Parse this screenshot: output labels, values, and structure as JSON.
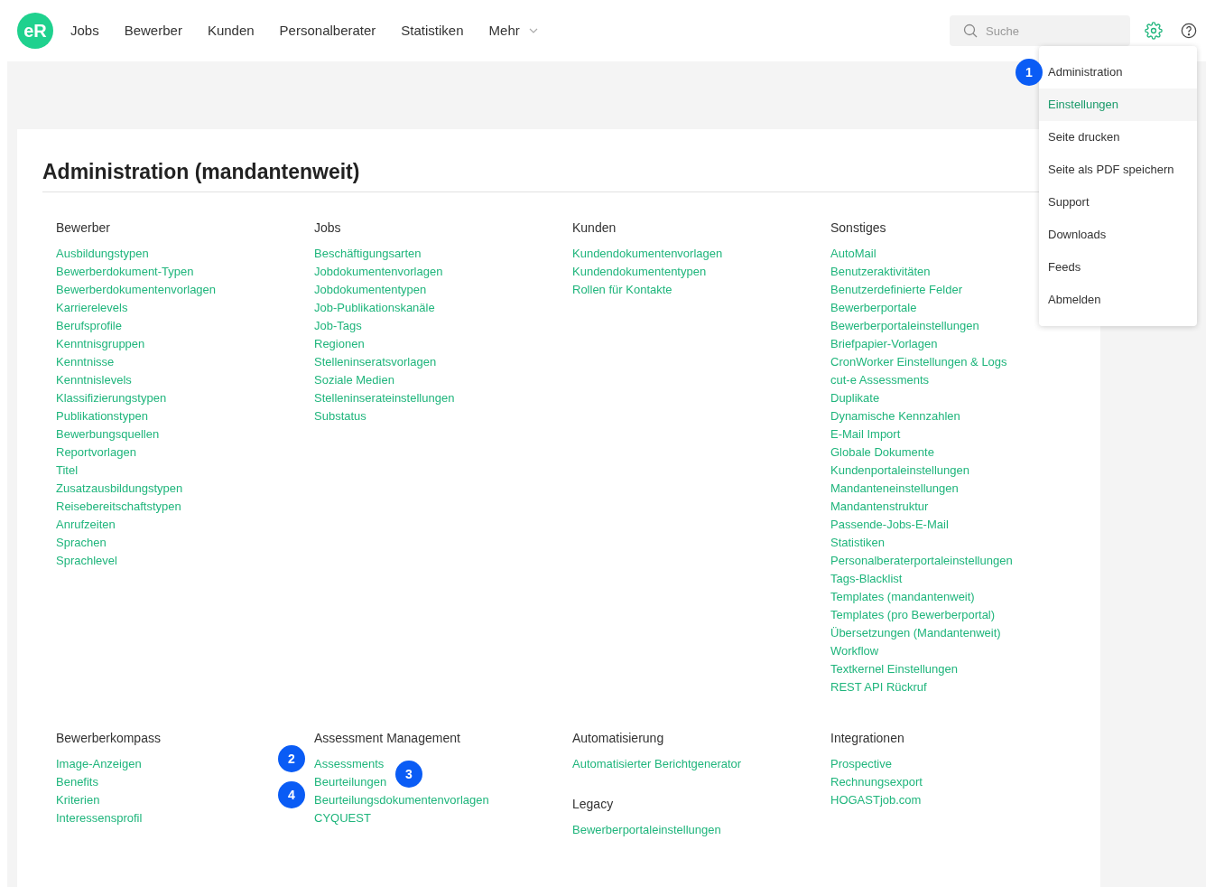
{
  "nav": {
    "logo": "eR",
    "items": [
      {
        "label": "Jobs"
      },
      {
        "label": "Bewerber"
      },
      {
        "label": "Kunden"
      },
      {
        "label": "Personalberater"
      },
      {
        "label": "Statistiken"
      },
      {
        "label": "Mehr",
        "dropdown": true
      }
    ],
    "search": {
      "placeholder": "Suche"
    }
  },
  "menu": {
    "items": [
      {
        "label": "Administration",
        "highlighted": false,
        "marker": "1"
      },
      {
        "label": "Einstellungen",
        "highlighted": true
      },
      {
        "label": "Seite drucken",
        "highlighted": false
      },
      {
        "label": "Seite als PDF speichern",
        "highlighted": false
      },
      {
        "label": "Support",
        "highlighted": false
      },
      {
        "label": "Downloads",
        "highlighted": false
      },
      {
        "label": "Feeds",
        "highlighted": false
      },
      {
        "label": "Abmelden",
        "highlighted": false
      }
    ]
  },
  "page": {
    "title": "Administration (mandantenweit)",
    "rows": [
      {
        "columns": [
          {
            "groups": [
              {
                "heading": "Bewerber",
                "links": [
                  {
                    "label": "Ausbildungstypen"
                  },
                  {
                    "label": "Bewerberdokument-Typen"
                  },
                  {
                    "label": "Bewerberdokumentenvorlagen"
                  },
                  {
                    "label": "Karrierelevels"
                  },
                  {
                    "label": "Berufsprofile"
                  },
                  {
                    "label": "Kenntnisgruppen"
                  },
                  {
                    "label": "Kenntnisse"
                  },
                  {
                    "label": "Kenntnislevels"
                  },
                  {
                    "label": "Klassifizierungstypen"
                  },
                  {
                    "label": "Publikationstypen"
                  },
                  {
                    "label": "Bewerbungsquellen"
                  },
                  {
                    "label": "Reportvorlagen"
                  },
                  {
                    "label": "Titel"
                  },
                  {
                    "label": "Zusatzausbildungstypen"
                  },
                  {
                    "label": "Reisebereitschaftstypen"
                  },
                  {
                    "label": "Anrufzeiten"
                  },
                  {
                    "label": "Sprachen"
                  },
                  {
                    "label": "Sprachlevel"
                  }
                ]
              }
            ]
          },
          {
            "groups": [
              {
                "heading": "Jobs",
                "links": [
                  {
                    "label": "Beschäftigungsarten"
                  },
                  {
                    "label": "Jobdokumentenvorlagen"
                  },
                  {
                    "label": "Jobdokumententypen"
                  },
                  {
                    "label": "Job-Publikationskanäle"
                  },
                  {
                    "label": "Job-Tags"
                  },
                  {
                    "label": "Regionen"
                  },
                  {
                    "label": "Stelleninseratsvorlagen"
                  },
                  {
                    "label": "Soziale Medien"
                  },
                  {
                    "label": "Stelleninserateinstellungen"
                  },
                  {
                    "label": "Substatus"
                  }
                ]
              }
            ]
          },
          {
            "groups": [
              {
                "heading": "Kunden",
                "links": [
                  {
                    "label": "Kundendokumentenvorlagen"
                  },
                  {
                    "label": "Kundendokumententypen"
                  },
                  {
                    "label": "Rollen für Kontakte"
                  }
                ]
              }
            ]
          },
          {
            "groups": [
              {
                "heading": "Sonstiges",
                "links": [
                  {
                    "label": "AutoMail"
                  },
                  {
                    "label": "Benutzeraktivitäten"
                  },
                  {
                    "label": "Benutzerdefinierte Felder"
                  },
                  {
                    "label": "Bewerberportale"
                  },
                  {
                    "label": "Bewerberportaleinstellungen"
                  },
                  {
                    "label": "Briefpapier-Vorlagen"
                  },
                  {
                    "label": "CronWorker Einstellungen & Logs"
                  },
                  {
                    "label": "cut-e Assessments"
                  },
                  {
                    "label": "Duplikate"
                  },
                  {
                    "label": "Dynamische Kennzahlen"
                  },
                  {
                    "label": "E-Mail Import"
                  },
                  {
                    "label": "Globale Dokumente"
                  },
                  {
                    "label": "Kundenportaleinstellungen"
                  },
                  {
                    "label": "Mandanteneinstellungen"
                  },
                  {
                    "label": "Mandantenstruktur"
                  },
                  {
                    "label": "Passende-Jobs-E-Mail"
                  },
                  {
                    "label": "Statistiken"
                  },
                  {
                    "label": "Personalberaterportaleinstellungen"
                  },
                  {
                    "label": "Tags-Blacklist"
                  },
                  {
                    "label": "Templates (mandantenweit)"
                  },
                  {
                    "label": "Templates (pro Bewerberportal)"
                  },
                  {
                    "label": "Übersetzungen (Mandantenweit)"
                  },
                  {
                    "label": "Workflow"
                  },
                  {
                    "label": "Textkernel Einstellungen"
                  },
                  {
                    "label": "REST API Rückruf"
                  }
                ]
              }
            ]
          }
        ]
      },
      {
        "columns": [
          {
            "groups": [
              {
                "heading": "Bewerberkompass",
                "links": [
                  {
                    "label": "Image-Anzeigen"
                  },
                  {
                    "label": "Benefits"
                  },
                  {
                    "label": "Kriterien"
                  },
                  {
                    "label": "Interessensprofil"
                  }
                ]
              }
            ]
          },
          {
            "groups": [
              {
                "heading": "Assessment Management",
                "links": [
                  {
                    "label": "Assessments",
                    "marker": "2",
                    "marker_after": false
                  },
                  {
                    "label": "Beurteilungen",
                    "marker": "3",
                    "marker_after": true
                  },
                  {
                    "label": "Beurteilungsdokumentenvorlagen",
                    "marker": "4",
                    "marker_after": false
                  },
                  {
                    "label": "CYQUEST"
                  }
                ]
              }
            ]
          },
          {
            "groups": [
              {
                "heading": "Automatisierung",
                "links": [
                  {
                    "label": "Automatisierter Berichtgenerator"
                  }
                ]
              },
              {
                "heading": "Legacy",
                "links": [
                  {
                    "label": "Bewerberportaleinstellungen"
                  }
                ]
              }
            ]
          },
          {
            "groups": [
              {
                "heading": "Integrationen",
                "links": [
                  {
                    "label": "Prospective"
                  },
                  {
                    "label": "Rechnungsexport"
                  },
                  {
                    "label": "HOGASTjob.com"
                  }
                ]
              }
            ]
          }
        ]
      }
    ]
  }
}
